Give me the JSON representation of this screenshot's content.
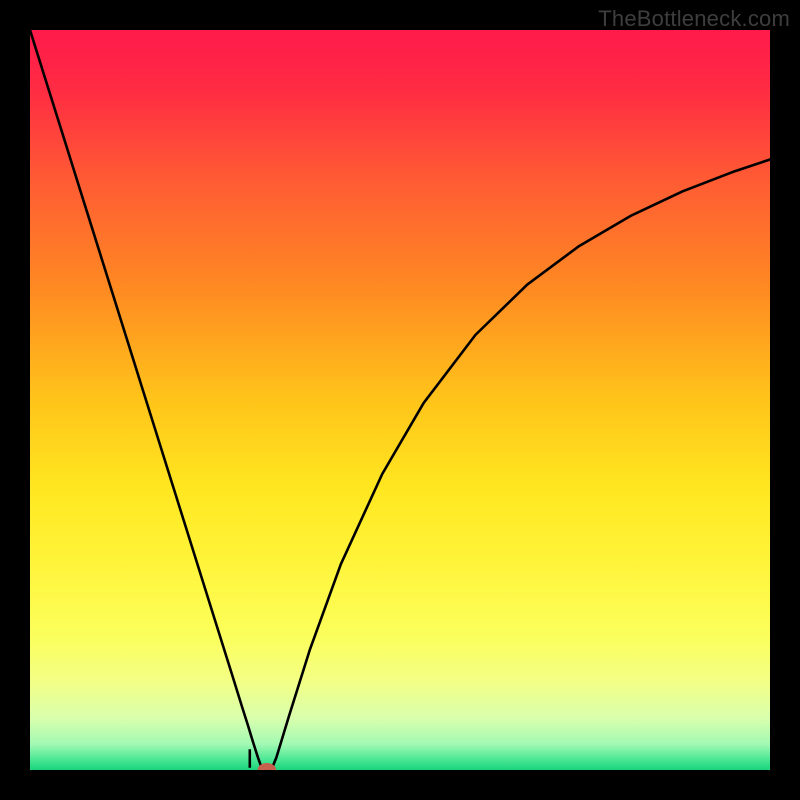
{
  "watermark": {
    "text": "TheBottleneck.com"
  },
  "colors": {
    "frame": "#000000",
    "gradient_stops": [
      {
        "offset": 0.0,
        "color": "#ff1a4b"
      },
      {
        "offset": 0.08,
        "color": "#ff2b43"
      },
      {
        "offset": 0.2,
        "color": "#ff5a34"
      },
      {
        "offset": 0.35,
        "color": "#ff8a22"
      },
      {
        "offset": 0.5,
        "color": "#ffc41a"
      },
      {
        "offset": 0.62,
        "color": "#ffe720"
      },
      {
        "offset": 0.72,
        "color": "#fff43a"
      },
      {
        "offset": 0.82,
        "color": "#fbff5c"
      },
      {
        "offset": 0.88,
        "color": "#f3ff85"
      },
      {
        "offset": 0.93,
        "color": "#d9ffad"
      },
      {
        "offset": 0.965,
        "color": "#a2f9b3"
      },
      {
        "offset": 0.985,
        "color": "#4fe896"
      },
      {
        "offset": 1.0,
        "color": "#19d47c"
      }
    ],
    "curve": "#000000",
    "marker_fill": "#c6614e",
    "marker_stroke": "#c6614e"
  },
  "chart_data": {
    "type": "line",
    "title": "",
    "xlabel": "",
    "ylabel": "",
    "xlim": [
      0,
      100
    ],
    "ylim": [
      0,
      100
    ],
    "grid": false,
    "legend": false,
    "series": [
      {
        "name": "bottleneck-curve",
        "x": [
          0.0,
          2.1,
          4.2,
          6.3,
          8.4,
          10.5,
          12.6,
          14.7,
          16.8,
          18.9,
          21.0,
          23.1,
          25.2,
          27.3,
          28.7,
          29.4,
          30.1,
          30.8,
          31.3,
          32.0,
          32.6,
          33.3,
          35.0,
          37.8,
          42.0,
          47.6,
          53.2,
          60.2,
          67.2,
          74.2,
          81.2,
          88.2,
          95.2,
          100.0
        ],
        "y": [
          100.0,
          93.3,
          86.6,
          79.9,
          73.2,
          66.5,
          59.8,
          53.1,
          46.4,
          39.7,
          33.0,
          26.3,
          19.6,
          12.9,
          8.4,
          6.2,
          3.9,
          1.7,
          0.3,
          0.0,
          0.0,
          1.7,
          7.3,
          16.2,
          27.8,
          40.0,
          49.6,
          58.8,
          65.6,
          70.8,
          74.9,
          78.2,
          80.9,
          82.5
        ]
      }
    ],
    "marker": {
      "x": 32.0,
      "y": 0.0,
      "rx": 1.2,
      "ry": 0.9
    },
    "notch": {
      "x": 29.7,
      "y_from": 0.3,
      "y_to": 2.8
    }
  }
}
